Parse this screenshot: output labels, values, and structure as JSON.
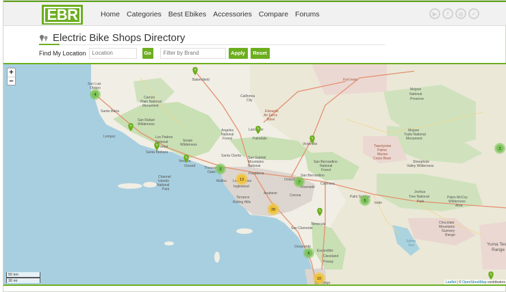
{
  "header": {
    "logo": "EBR",
    "nav": [
      "Home",
      "Categories",
      "Best Ebikes",
      "Accessories",
      "Compare",
      "Forums"
    ],
    "social_icons": [
      "youtube-icon",
      "facebook-icon",
      "instagram-icon",
      "twitter-icon"
    ]
  },
  "page": {
    "title": "Electric Bike Shops Directory",
    "find_label": "Find My Location",
    "location_placeholder": "Location",
    "go_label": "Go",
    "brand_placeholder": "Filter by Brand",
    "apply_label": "Apply",
    "reset_label": "Reset"
  },
  "map": {
    "zoom_in": "+",
    "zoom_out": "−",
    "scale_km": "50 km",
    "scale_mi": "30 mi",
    "attribution_leaflet": "Leaflet",
    "attribution_sep": " | © ",
    "attribution_osm": "OpenStreetMap",
    "attribution_tail": " contributors",
    "places": [
      {
        "name": "San Luis Obispo"
      },
      {
        "name": "Bakersfield"
      },
      {
        "name": "Fort Irwin"
      },
      {
        "name": "Mojave National Preserve"
      },
      {
        "name": "Carrizo Plain National Monument"
      },
      {
        "name": "California City"
      },
      {
        "name": "Edwards Air Force Base"
      },
      {
        "name": "Santa Maria"
      },
      {
        "name": "Lompoc"
      },
      {
        "name": "San Rafael Wilderness"
      },
      {
        "name": "Los Padres National Forest"
      },
      {
        "name": "Santa Barbara"
      },
      {
        "name": "Sespe Wilderness"
      },
      {
        "name": "Angeles National Forest"
      },
      {
        "name": "Lancaster"
      },
      {
        "name": "Palmdale"
      },
      {
        "name": "Victorville"
      },
      {
        "name": "Mojave Trails National Monument"
      },
      {
        "name": "Twentynine Palms Marine Corps Base"
      },
      {
        "name": "Sheephole Valley Wilderness"
      },
      {
        "name": "Santa Clarita"
      },
      {
        "name": "San Gabriel Mountains National Monument"
      },
      {
        "name": "San Bernardino National Forest"
      },
      {
        "name": "Oxnard"
      },
      {
        "name": "Ventura"
      },
      {
        "name": "Thousand Oaks"
      },
      {
        "name": "Malibu"
      },
      {
        "name": "Los Angeles"
      },
      {
        "name": "Pasadena"
      },
      {
        "name": "Ontario"
      },
      {
        "name": "San Bernardino"
      },
      {
        "name": "Riverside"
      },
      {
        "name": "Calimesa"
      },
      {
        "name": "Palm Springs"
      },
      {
        "name": "Indio"
      },
      {
        "name": "Joshua Tree National Park"
      },
      {
        "name": "Palen McCoy Wilderness Area"
      },
      {
        "name": "Channel Islands National Park"
      },
      {
        "name": "Inglewood"
      },
      {
        "name": "Torrance"
      },
      {
        "name": "Rolling Hills"
      },
      {
        "name": "Anaheim"
      },
      {
        "name": "Corona"
      },
      {
        "name": "Temecula"
      },
      {
        "name": "San Clemente"
      },
      {
        "name": "Oceanside"
      },
      {
        "name": "Escondido"
      },
      {
        "name": "Poway"
      },
      {
        "name": "Cleveland National Forest"
      },
      {
        "name": "San Diego"
      },
      {
        "name": "Chocolate Mountains Gunnery Range"
      },
      {
        "name": "Yuma Test Range"
      },
      {
        "name": "Salton Sea"
      }
    ],
    "clusters": [
      {
        "count": "4",
        "color": "green"
      },
      {
        "count": "2",
        "color": "green"
      },
      {
        "count": "3",
        "color": "green"
      },
      {
        "count": "13",
        "color": "yellow"
      },
      {
        "count": "7",
        "color": "green"
      },
      {
        "count": "5",
        "color": "green"
      },
      {
        "count": "28",
        "color": "yellow"
      },
      {
        "count": "6",
        "color": "green"
      },
      {
        "count": "10",
        "color": "yellow"
      }
    ],
    "markers": [
      "bakersfield",
      "lompoc",
      "santa-barbara",
      "ventura",
      "palmdale",
      "victorville",
      "temecula",
      "yuma"
    ]
  }
}
